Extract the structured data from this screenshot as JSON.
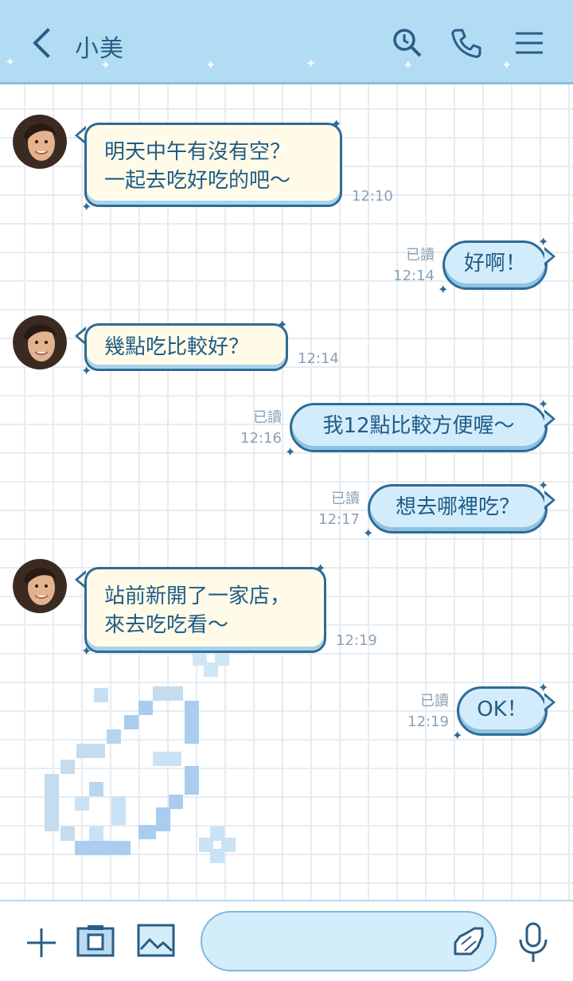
{
  "header": {
    "title": "小美",
    "back_icon": "chevron-left-icon",
    "icons": [
      "search-icon",
      "phone-icon",
      "menu-icon"
    ],
    "bg_color": "#b1dcf4",
    "accent_color": "#2a5d85"
  },
  "messages": [
    {
      "dir": "in",
      "lines": [
        "明天中午有沒有空？",
        "一起去吃好吃的吧～"
      ],
      "time": "12:10"
    },
    {
      "dir": "out",
      "text": "好啊！",
      "read": "已讀",
      "time": "12:14"
    },
    {
      "dir": "in",
      "lines": [
        "幾點吃比較好？"
      ],
      "time": "12:14"
    },
    {
      "dir": "out",
      "text": "我12點比較方便喔～",
      "read": "已讀",
      "time": "12:16"
    },
    {
      "dir": "out",
      "text": "想去哪裡吃？",
      "read": "已讀",
      "time": "12:17"
    },
    {
      "dir": "in",
      "lines": [
        "站前新開了一家店，",
        "來去吃吃看～"
      ],
      "time": "12:19"
    },
    {
      "dir": "out",
      "text": "OK！",
      "read": "已讀",
      "time": "12:19"
    }
  ],
  "footer": {
    "icons": [
      "plus-icon",
      "camera-icon",
      "image-icon",
      "emoji-icon",
      "microphone-icon"
    ],
    "input_placeholder": ""
  },
  "colors": {
    "incoming_bubble": "#fffbe8",
    "outgoing_bubble": "#d3ecfb",
    "bubble_border": "#2f6b95",
    "text": "#1f5c86",
    "meta_text": "#8ba2b4"
  }
}
